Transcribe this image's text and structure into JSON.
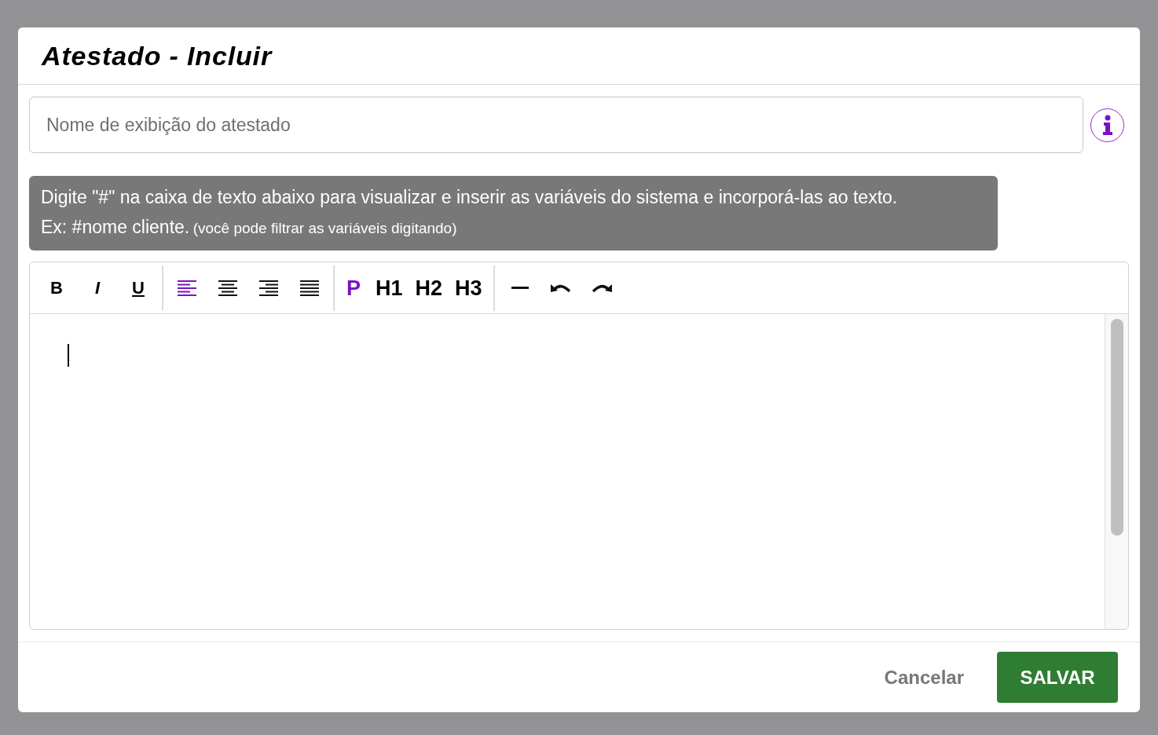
{
  "dialog": {
    "title": "Atestado - Incluir",
    "name_field": {
      "placeholder": "Nome de exibição do atestado"
    },
    "hint": {
      "line1": "Digite \"#\" na caixa de texto abaixo para visualizar e inserir as variáveis do sistema e incorporá-las ao texto.",
      "line2": "Ex: #nome cliente.",
      "line2_note": "(você pode filtrar as variáveis digitando)"
    },
    "toolbar": {
      "format": [
        "B",
        "I",
        "U"
      ],
      "align": [
        {
          "selected": true
        },
        {
          "selected": false
        },
        {
          "selected": false
        },
        {
          "selected": false
        }
      ],
      "blocks": [
        {
          "label": "P",
          "selected": true
        },
        {
          "label": "H1",
          "selected": false
        },
        {
          "label": "H2",
          "selected": false
        },
        {
          "label": "H3",
          "selected": false
        }
      ]
    },
    "buttons": {
      "cancel": "Cancelar",
      "save": "SALVAR"
    }
  }
}
